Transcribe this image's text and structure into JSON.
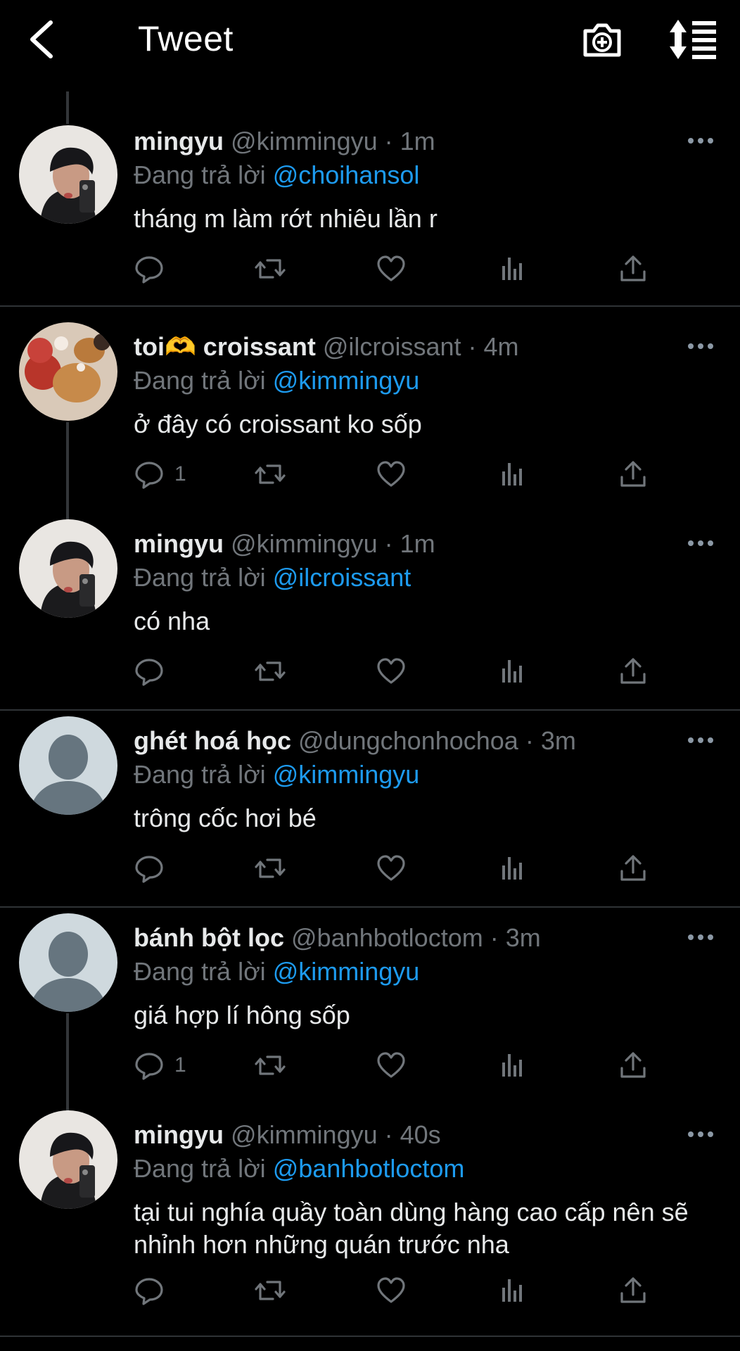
{
  "header": {
    "title": "Tweet",
    "back_icon": "chevron-left-icon",
    "camera_icon": "camera-plus-icon",
    "sort_icon": "sort-icon"
  },
  "colors": {
    "background": "#000000",
    "text": "#e7e9ea",
    "muted": "#71767b",
    "accent": "#1d9bf0",
    "divider": "#2f3336"
  },
  "reply_prefix": "Đang trả lời",
  "tweets": [
    {
      "name": "mingyu",
      "handle": "@kimmingyu",
      "time": "· 1m",
      "reply_to": "@choihansol",
      "text": "tháng m làm rớt nhiêu lần r",
      "replies": ""
    },
    {
      "name": "toi🫶 croissant",
      "handle": "@ilcroissant",
      "time": "· 4m",
      "reply_to": "@kimmingyu",
      "text": "ở đây có croissant ko sốp",
      "replies": "1"
    },
    {
      "name": "mingyu",
      "handle": "@kimmingyu",
      "time": "· 1m",
      "reply_to": "@ilcroissant",
      "text": "có nha",
      "replies": ""
    },
    {
      "name": "ghét hoá học",
      "handle": "@dungchonhochoa",
      "time": "· 3m",
      "reply_to": "@kimmingyu",
      "text": "trông cốc hơi bé",
      "replies": ""
    },
    {
      "name": "bánh bột lọc",
      "handle": "@banhbotloctom",
      "time": "· 3m",
      "reply_to": "@kimmingyu",
      "text": "giá hợp lí hông sốp",
      "replies": "1"
    },
    {
      "name": "mingyu",
      "handle": "@kimmingyu",
      "time": "· 40s",
      "reply_to": "@banhbotloctom",
      "text": "tại tui nghía quầy toàn dùng hàng cao cấp nên sẽ nhỉnh hơn những quán trước nha",
      "replies": ""
    }
  ]
}
